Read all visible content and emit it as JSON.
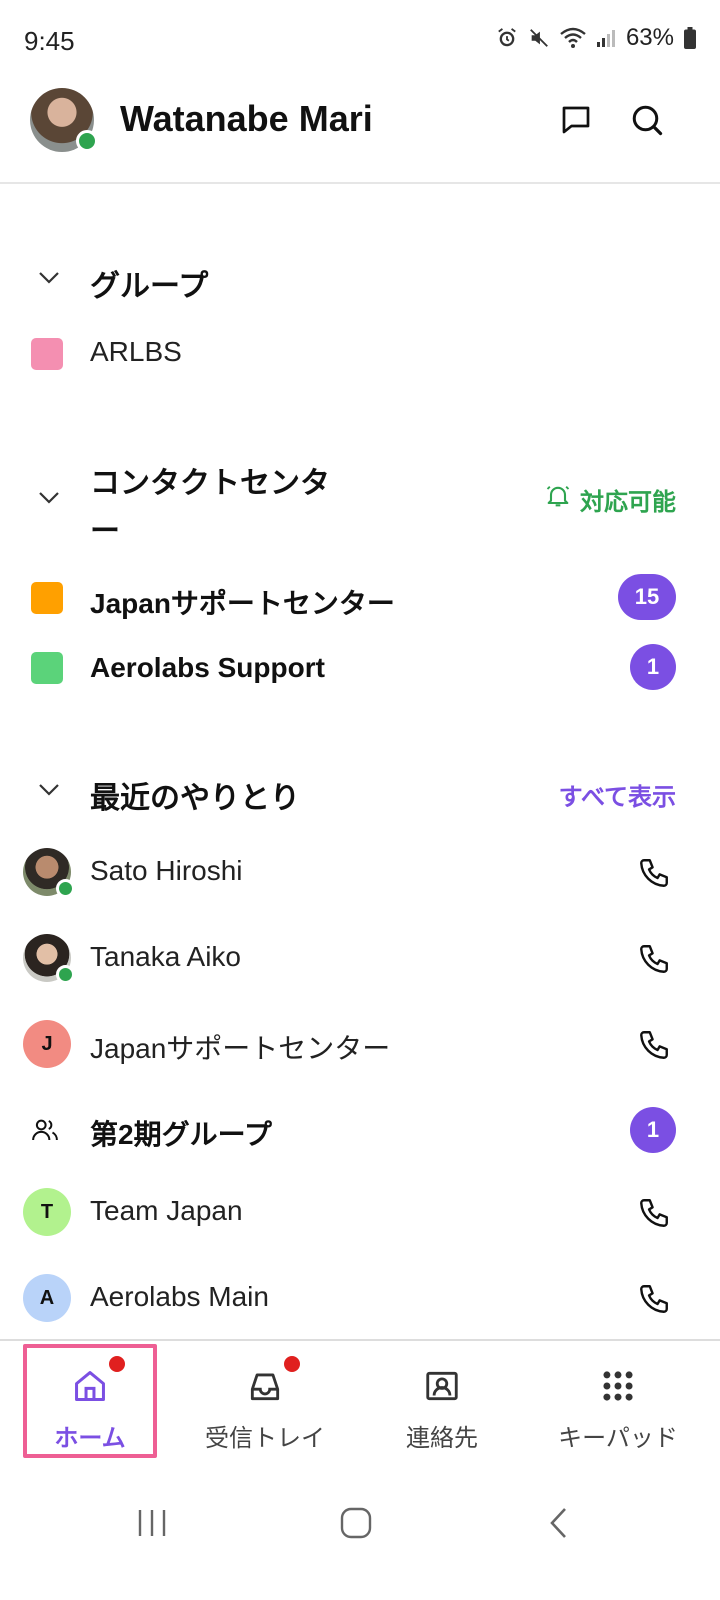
{
  "status_bar": {
    "time": "9:45",
    "battery": "63%"
  },
  "header": {
    "user_name": "Watanabe Mari"
  },
  "groups": {
    "title": "グループ",
    "items": [
      {
        "label": "ARLBS",
        "color": "#f48fb1"
      }
    ]
  },
  "contact_center": {
    "title": "コンタクトセンター",
    "availability": "対応可能",
    "items": [
      {
        "label": "Japanサポートセンター",
        "color": "#ffa000",
        "badge": "15"
      },
      {
        "label": "Aerolabs Support",
        "color": "#5bd37a",
        "badge": "1"
      }
    ]
  },
  "recent": {
    "title": "最近のやりとり",
    "show_all": "すべて表示",
    "items": [
      {
        "label": "Sato Hiroshi",
        "avatar": "photo",
        "action": "phone-icon"
      },
      {
        "label": "Tanaka Aiko",
        "avatar": "photo",
        "action": "phone-icon"
      },
      {
        "label": "Japanサポートセンター",
        "initial": "J",
        "avatar_color": "#f28b82",
        "action": "phone-icon"
      },
      {
        "label": "第2期グループ",
        "avatar": "group-icon",
        "badge": "1"
      },
      {
        "label": "Team Japan",
        "initial": "T",
        "avatar_color": "#b2f28e",
        "action": "phone-icon"
      },
      {
        "label": "Aerolabs Main",
        "initial": "A",
        "avatar_color": "#b9d3f9",
        "action": "phone-icon"
      }
    ]
  },
  "tabs": [
    {
      "label": "ホーム",
      "icon": "home-icon",
      "active": true,
      "dot": true
    },
    {
      "label": "受信トレイ",
      "icon": "inbox-icon",
      "active": false,
      "dot": true
    },
    {
      "label": "連絡先",
      "icon": "contacts-icon",
      "active": false,
      "dot": false
    },
    {
      "label": "キーパッド",
      "icon": "keypad-icon",
      "active": false,
      "dot": false
    }
  ],
  "colors": {
    "accent": "#7b4fe3",
    "online": "#2ea44f",
    "available": "#2ea44f",
    "highlight": "#ee5f94"
  }
}
